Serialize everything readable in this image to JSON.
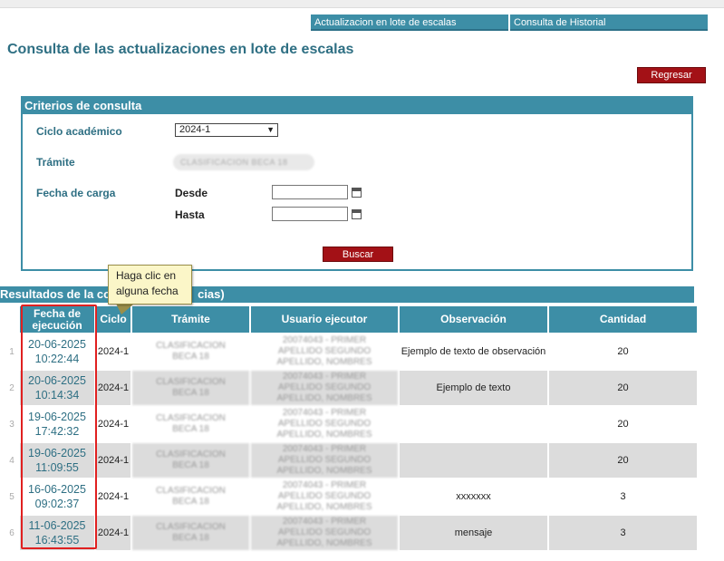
{
  "nav": {
    "links": [
      "Actualizacion en lote de escalas",
      "Consulta de Historial"
    ]
  },
  "page": {
    "title": "Consulta de las actualizaciones en lote de escalas",
    "back_label": "Regresar"
  },
  "criteria": {
    "header": "Criterios de consulta",
    "cycle_label": "Ciclo académico",
    "cycle_value": "2024-1",
    "procedure_label": "Trámite",
    "procedure_value": "CLASIFICACION BECA 18",
    "upload_date_label": "Fecha de carga",
    "from_label": "Desde",
    "to_label": "Hasta",
    "search_label": "Buscar"
  },
  "results": {
    "header_visible": "Resultados de la co",
    "header_tail": "cias)",
    "tooltip": "Haga clic en alguna fecha",
    "columns": [
      "Fecha de ejecución",
      "Ciclo",
      "Trámite",
      "Usuario ejecutor",
      "Observación",
      "Cantidad"
    ],
    "rows": [
      {
        "n": "1",
        "date": "20-06-2025",
        "time": "10:22:44",
        "cycle": "2024-1",
        "procedure": "CLASIFICACION BECA 18",
        "user": "20074043 - PRIMER APELLIDO SEGUNDO APELLIDO, NOMBRES",
        "observation": "Ejemplo de texto de observación",
        "quantity": "20"
      },
      {
        "n": "2",
        "date": "20-06-2025",
        "time": "10:14:34",
        "cycle": "2024-1",
        "procedure": "CLASIFICACION BECA 18",
        "user": "20074043 - PRIMER APELLIDO SEGUNDO APELLIDO, NOMBRES",
        "observation": "Ejemplo de texto",
        "quantity": "20"
      },
      {
        "n": "3",
        "date": "19-06-2025",
        "time": "17:42:32",
        "cycle": "2024-1",
        "procedure": "CLASIFICACION BECA 18",
        "user": "20074043 - PRIMER APELLIDO SEGUNDO APELLIDO, NOMBRES",
        "observation": "",
        "quantity": "20"
      },
      {
        "n": "4",
        "date": "19-06-2025",
        "time": "11:09:55",
        "cycle": "2024-1",
        "procedure": "CLASIFICACION BECA 18",
        "user": "20074043 - PRIMER APELLIDO SEGUNDO APELLIDO, NOMBRES",
        "observation": "",
        "quantity": "20"
      },
      {
        "n": "5",
        "date": "16-06-2025",
        "time": "09:02:37",
        "cycle": "2024-1",
        "procedure": "CLASIFICACION BECA 18",
        "user": "20074043 - PRIMER APELLIDO SEGUNDO APELLIDO, NOMBRES",
        "observation": "xxxxxxx",
        "quantity": "3"
      },
      {
        "n": "6",
        "date": "11-06-2025",
        "time": "16:43:55",
        "cycle": "2024-1",
        "procedure": "CLASIFICACION BECA 18",
        "user": "20074043 - PRIMER APELLIDO SEGUNDO APELLIDO, NOMBRES",
        "observation": "mensaje",
        "quantity": "3"
      }
    ]
  },
  "colors": {
    "teal": "#3d8ea6",
    "title_teal": "#2e6f83",
    "red_button": "#a31116",
    "highlight": "#e02020",
    "tooltip_bg": "#fbf6c8"
  }
}
